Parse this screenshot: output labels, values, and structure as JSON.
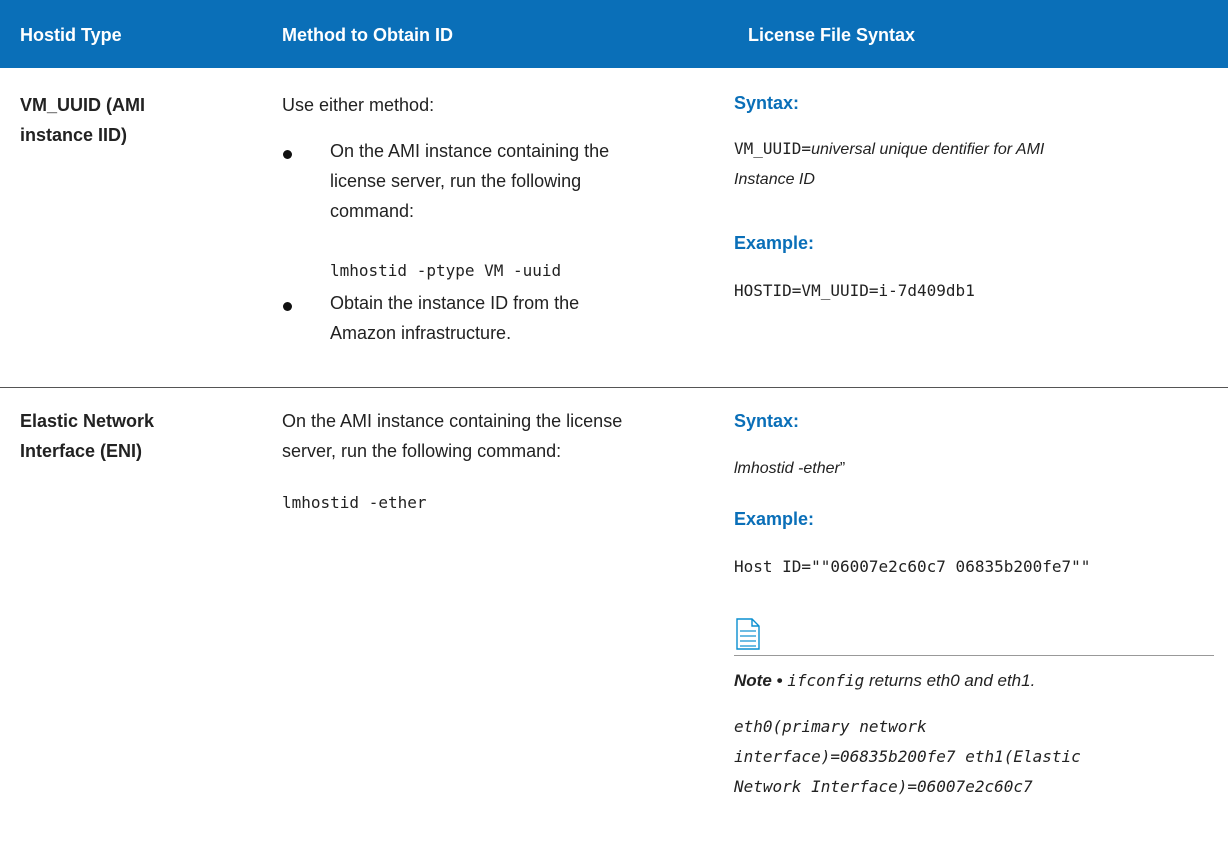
{
  "header": {
    "col1": "Hostid Type",
    "col2": "Method to Obtain ID",
    "col3": "License File Syntax"
  },
  "row1": {
    "type_line1": "VM_UUID (AMI",
    "type_line2": "instance IID)",
    "method_intro": "Use either method:",
    "bullet1_line1": "On the AMI instance containing the",
    "bullet1_line2": "license server, run the following",
    "bullet1_line3": "command:",
    "bullet1_command": "lmhostid -ptype VM -uuid",
    "bullet2_line1": "Obtain the instance ID from the",
    "bullet2_line2": "Amazon infrastructure.",
    "syntax_heading": "Syntax:",
    "syntax_prefix": "VM_UUID=",
    "syntax_italic1": "universal unique dentifier for AMI",
    "syntax_italic2": "Instance ID",
    "example_heading": "Example:",
    "example_value": "HOSTID=VM_UUID=i-7d409db1"
  },
  "row2": {
    "type_line1": "Elastic Network",
    "type_line2": "Interface (ENI)",
    "method_line1": "On the AMI instance containing the license",
    "method_line2": "server, run the following command:",
    "method_command": "lmhostid -ether",
    "syntax_heading": "Syntax:",
    "syntax_italic": "lmhostid -ether",
    "syntax_suffix": "”",
    "example_heading": "Example:",
    "example_value": "Host ID=\"\"06007e2c60c7 06835b200fe7\"\"",
    "note_label": "Note •",
    "note_code": "ifconfig",
    "note_text": " returns eth0 and eth1.",
    "note_detail_line1": "eth0(primary network",
    "note_detail_line2": "interface)=06835b200fe7 eth1(Elastic",
    "note_detail_line3": "Network Interface)=06007e2c60c7"
  },
  "colors": {
    "header_bg": "#0a6fb8",
    "heading_blue": "#0a6fb8"
  },
  "icons": {
    "note": "note-document-icon"
  }
}
